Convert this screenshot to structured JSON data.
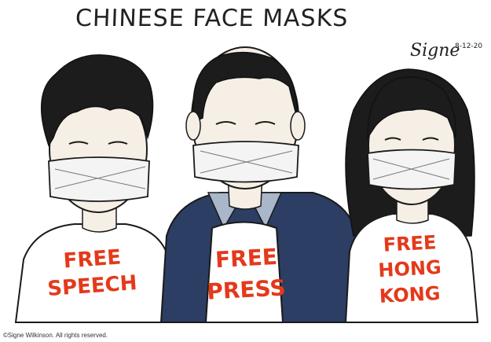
{
  "cartoon": {
    "title": "CHINESE FACE MASKS",
    "signature": "Signe",
    "signature_date": "8-12-20",
    "copyright": "©Signe Wilkinson.  All rights reserved."
  },
  "figures": [
    {
      "shirt_lines": [
        "FREE",
        "SPEECH"
      ]
    },
    {
      "shirt_lines": [
        "FREE",
        "PRESS"
      ]
    },
    {
      "shirt_lines": [
        "FREE",
        "HONG",
        "KONG"
      ]
    }
  ],
  "colors": {
    "shirt_text": "#e4391b",
    "suit": "#2c3e63",
    "ink": "#1a1a1a",
    "skin": "#f6efe6",
    "mask": "#f4f4f4"
  }
}
